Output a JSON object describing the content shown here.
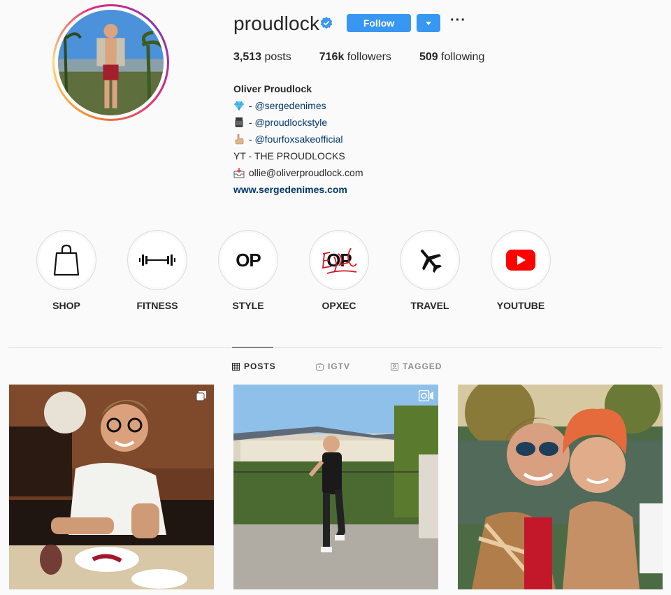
{
  "profile": {
    "username": "proudlock",
    "verified": true,
    "follow_label": "Follow",
    "stats": {
      "posts_value": "3,513",
      "posts_label": "posts",
      "followers_value": "716k",
      "followers_label": "followers",
      "following_value": "509",
      "following_label": "following"
    },
    "bio": {
      "name": "Oliver Proudlock",
      "line1_prefix": " - ",
      "line1_link": "@sergedenimes",
      "line2_prefix": " - ",
      "line2_link": "@proudlockstyle",
      "line3_prefix": " - ",
      "line3_link": "@fourfoxsakeofficial",
      "line4": "YT - THE PROUDLOCKS",
      "line5": " ollie@oliverproudlock.com",
      "website": "www.sergedenimes.com"
    }
  },
  "highlights": [
    {
      "label": "SHOP",
      "icon": "shopping-bag-icon"
    },
    {
      "label": "FITNESS",
      "icon": "dumbbell-icon"
    },
    {
      "label": "STYLE",
      "icon": "op-logo",
      "text": "OP"
    },
    {
      "label": "OPXEC",
      "icon": "op-exec-logo",
      "text": "OP"
    },
    {
      "label": "TRAVEL",
      "icon": "airplane-icon"
    },
    {
      "label": "YOUTUBE",
      "icon": "youtube-icon"
    }
  ],
  "tabs": [
    {
      "label": "POSTS",
      "icon": "grid-icon",
      "active": true
    },
    {
      "label": "IGTV",
      "icon": "igtv-icon",
      "active": false
    },
    {
      "label": "TAGGED",
      "icon": "tagged-icon",
      "active": false
    }
  ],
  "posts": [
    {
      "type": "carousel",
      "icon": "carousel-icon"
    },
    {
      "type": "video",
      "icon": "video-icon"
    },
    {
      "type": "photo"
    }
  ],
  "colors": {
    "accent": "#3897f0",
    "link": "#00376b",
    "youtube_red": "#ff0000"
  }
}
